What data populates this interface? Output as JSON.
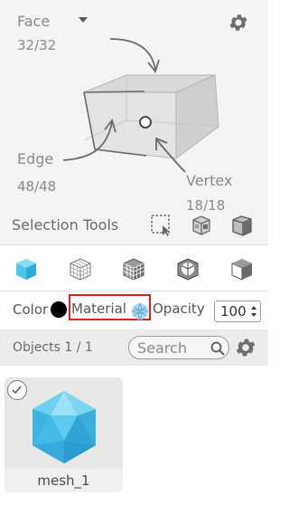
{
  "selection_stats": {
    "face": {
      "label": "Face",
      "count": "32/32"
    },
    "edge": {
      "label": "Edge",
      "count": "48/48"
    },
    "vertex": {
      "label": "Vertex",
      "count": "18/18"
    }
  },
  "selection_tools": {
    "label": "Selection Tools"
  },
  "properties": {
    "color_label": "Color",
    "material_label": "Material",
    "opacity_label": "Opacity",
    "opacity_value": "100"
  },
  "objects": {
    "label": "Objects 1 / 1",
    "search_placeholder": "Search"
  },
  "mesh_card": {
    "name": "mesh_1"
  },
  "colors": {
    "accent_blue": "#4fc3e8",
    "highlight_red": "#e02020",
    "panel_bg": "#f4f4f4"
  }
}
